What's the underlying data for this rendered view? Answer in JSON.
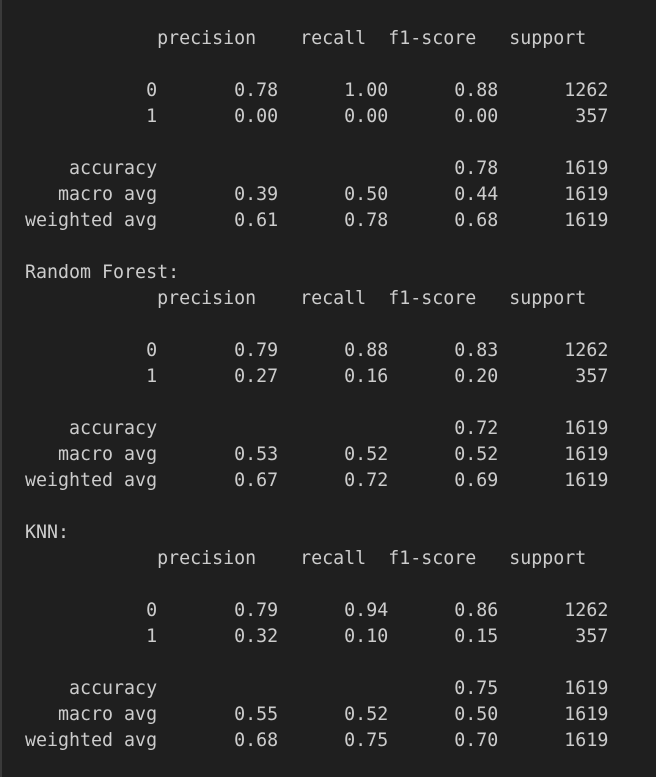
{
  "output_lines": [
    "            precision    recall  f1-score   support",
    "",
    "           0       0.78      1.00      0.88      1262",
    "           1       0.00      0.00      0.00       357",
    "",
    "    accuracy                           0.78      1619",
    "   macro avg       0.39      0.50      0.44      1619",
    "weighted avg       0.61      0.78      0.68      1619",
    "",
    "Random Forest:",
    "            precision    recall  f1-score   support",
    "",
    "           0       0.79      0.88      0.83      1262",
    "           1       0.27      0.16      0.20       357",
    "",
    "    accuracy                           0.72      1619",
    "   macro avg       0.53      0.52      0.52      1619",
    "weighted avg       0.67      0.72      0.69      1619",
    "",
    "KNN:",
    "            precision    recall  f1-score   support",
    "",
    "           0       0.79      0.94      0.86      1262",
    "           1       0.32      0.10      0.15       357",
    "",
    "    accuracy                           0.75      1619",
    "   macro avg       0.55      0.52      0.50      1619",
    "weighted avg       0.68      0.75      0.70      1619"
  ]
}
